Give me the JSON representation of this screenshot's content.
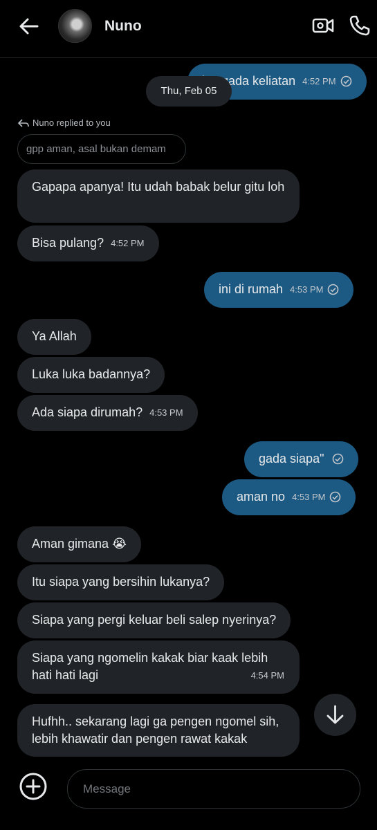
{
  "header": {
    "contact_name": "Nuno",
    "back_icon": "back-arrow-icon",
    "video_icon": "video-call-icon",
    "phone_icon": "phone-call-icon"
  },
  "date_separator": "Thu, Feb 05",
  "reply_context": {
    "label": "Nuno replied to you",
    "quoted_text": "gpp aman, asal bukan demam"
  },
  "messages": [
    {
      "direction": "out",
      "text": "iya gada keliatan",
      "time": "4:52 PM",
      "status": "sent"
    },
    {
      "direction": "in",
      "text": "Gapapa apanya! Itu udah babak belur gitu loh",
      "time": ""
    },
    {
      "direction": "in",
      "text": "Bisa pulang?",
      "time": "4:52 PM"
    },
    {
      "direction": "out",
      "text": "ini di rumah",
      "time": "4:53 PM",
      "status": "sent"
    },
    {
      "direction": "in",
      "text": "Ya Allah",
      "time": ""
    },
    {
      "direction": "in",
      "text": "Luka luka badannya?",
      "time": ""
    },
    {
      "direction": "in",
      "text": "Ada siapa dirumah?",
      "time": "4:53 PM"
    },
    {
      "direction": "out",
      "text": "gada siapa\"",
      "time": "",
      "status": "sent"
    },
    {
      "direction": "out",
      "text": "aman no",
      "time": "4:53 PM",
      "status": "sent"
    },
    {
      "direction": "in",
      "text": "Aman gimana 😭",
      "time": ""
    },
    {
      "direction": "in",
      "text": "Itu siapa yang bersihin lukanya?",
      "time": ""
    },
    {
      "direction": "in",
      "text": "Siapa yang pergi keluar beli salep nyerinya?",
      "time": ""
    },
    {
      "direction": "in",
      "text": "Siapa yang ngomelin kakak biar kaak lebih hati hati lagi",
      "time": "4:54 PM"
    },
    {
      "direction": "in",
      "text": "Hufhh.. sekarang lagi ga pengen ngomel sih, lebih khawatir dan pengen rawat kakak",
      "time": ""
    }
  ],
  "composer": {
    "placeholder": "Message",
    "add_icon": "plus-circle-icon"
  },
  "scroll_icon": "arrow-down-icon",
  "colors": {
    "background": "#000000",
    "incoming_bubble": "#202327",
    "outgoing_bubble": "#1d5a83",
    "text": "#e7e9ea"
  }
}
